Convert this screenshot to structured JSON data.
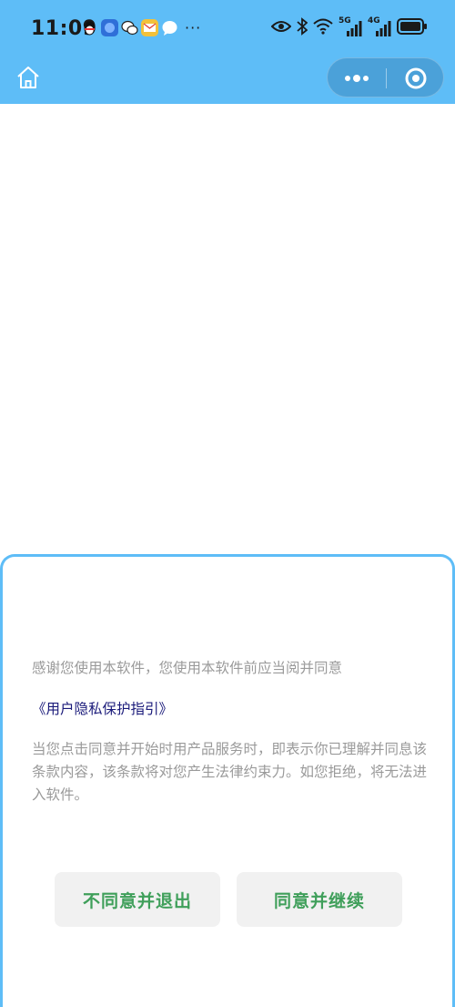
{
  "status_bar": {
    "time": "11:09",
    "more": "···",
    "network_1": "5G",
    "network_2": "4G"
  },
  "nav": {
    "home_icon": "home-icon",
    "more_icon": "more-dots-icon",
    "close_icon": "target-close-icon"
  },
  "dialog": {
    "intro": "感谢您使用本软件，您使用本软件前应当阅并同意",
    "policy_link": "《用户隐私保护指引》",
    "body": "当您点击同意并开始时用产品服务时，即表示你已理解并同息该条款内容，该条款将对您产生法律约束力。如您拒绝，将无法进入软件。",
    "decline_label": "不同意并退出",
    "agree_label": "同意并继续"
  },
  "colors": {
    "header": "#5ebdf7",
    "button_text": "#3f9f5a",
    "link": "#1a1a7a"
  }
}
